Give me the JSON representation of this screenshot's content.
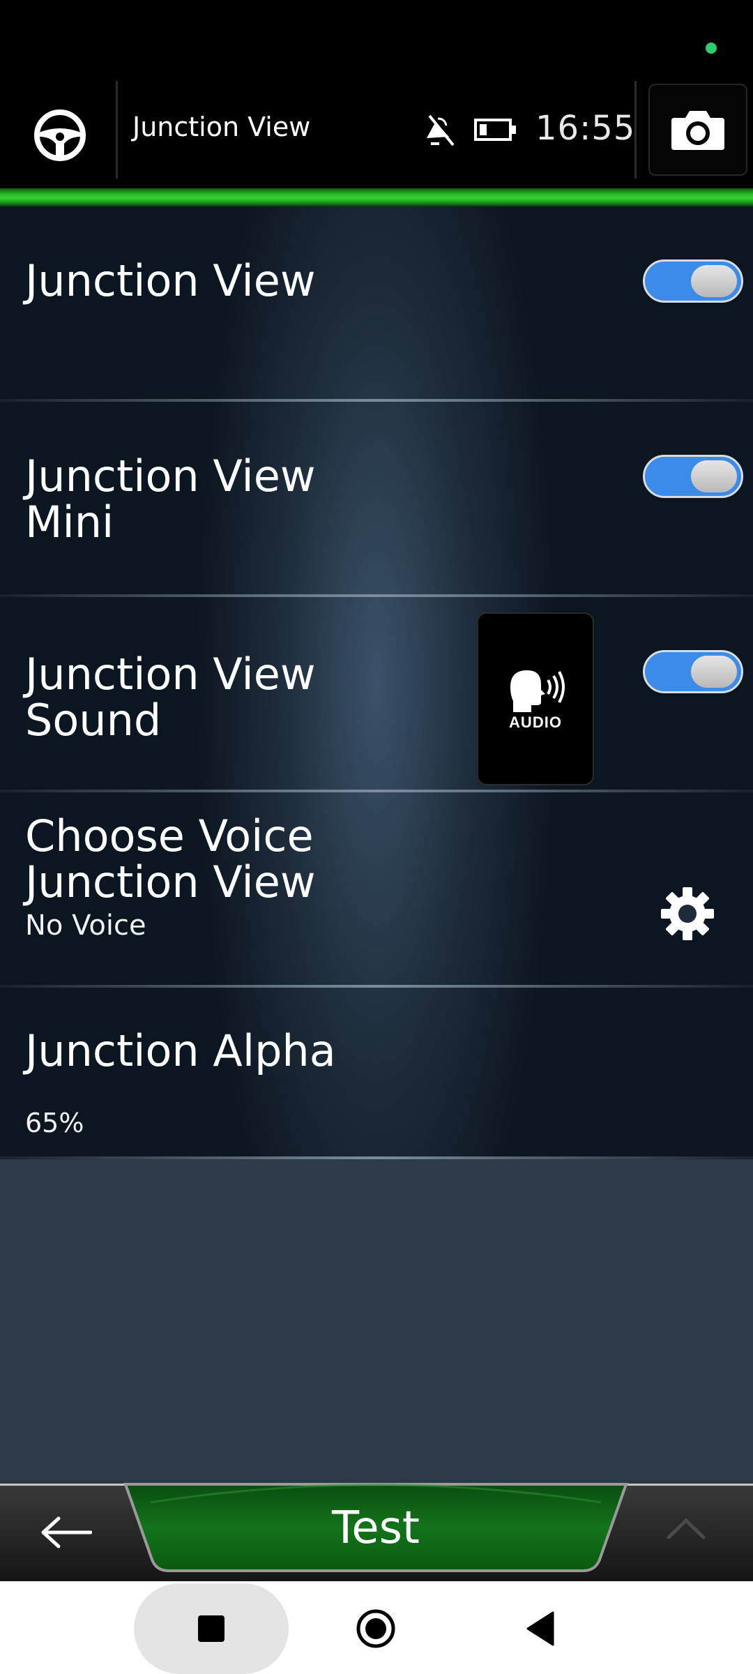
{
  "header": {
    "title": "Junction View",
    "time": "16:55"
  },
  "settings": [
    {
      "label": "Junction View",
      "toggle_on": true
    },
    {
      "label": "Junction View Mini",
      "toggle_on": true
    },
    {
      "label": "Junction View Sound",
      "toggle_on": true,
      "tile_caption": "AUDIO"
    },
    {
      "label": "Choose Voice Junction View",
      "value": "No Voice"
    },
    {
      "label": "Junction Alpha",
      "value": "65%"
    }
  ],
  "bottom_bar": {
    "test_label": "Test"
  },
  "colors": {
    "accent_green": "#34d431",
    "toggle_blue": "#3d8be8",
    "status_dot": "#2ecc71",
    "test_green": "#0e6a14"
  },
  "icons": [
    "steering-wheel-icon",
    "gps-off-icon",
    "battery-icon",
    "camera-icon",
    "speaking-head-icon",
    "gear-icon",
    "back-arrow-icon",
    "chevron-up-icon",
    "recents-square-icon",
    "home-circle-icon",
    "back-triangle-icon"
  ]
}
